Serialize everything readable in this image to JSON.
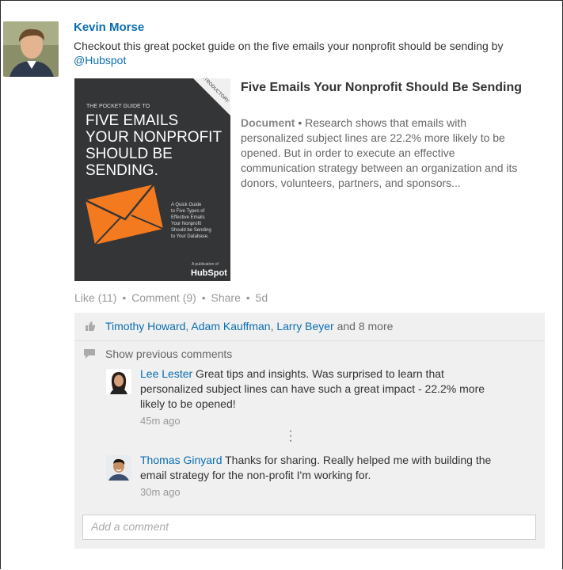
{
  "post": {
    "author": "Kevin Morse",
    "text": "Checkout this great pocket guide on the five emails your nonprofit should be sending by",
    "mention": "@Hubspot"
  },
  "document": {
    "thumbnail": {
      "banner": "INTRODUCTORY",
      "kicker": "THE POCKET GUIDE TO",
      "title_lines": [
        "FIVE EMAILS",
        "YOUR NONPROFIT",
        "SHOULD BE",
        "SENDING."
      ],
      "blurb_lines": [
        "A Quick Guide",
        "to Five Types of",
        "Effective Emails",
        "Your Nonprofit",
        "Should be Sending",
        "to Your Database."
      ],
      "publisher_label": "A publication of",
      "publisher": "HubSpot",
      "accent_color": "#f47a20"
    },
    "title": "Five Emails Your Nonprofit Should Be Sending",
    "type": "Document",
    "separator": " • ",
    "description": "Research shows that emails with personalized subject lines are 22.2% more likely to be opened. But in order to execute an effective communication strategy between an organization and its donors, volunteers, partners, and sponsors..."
  },
  "actions": {
    "like": "Like (11)",
    "comment": "Comment (9)",
    "share": "Share",
    "age": "5d",
    "dot": "•"
  },
  "likes": {
    "names": [
      "Timothy Howard",
      "Adam Kauffman",
      "Larry Beyer"
    ],
    "comma": ", ",
    "more": " and 8 more"
  },
  "comments_panel": {
    "show_previous": "Show previous comments",
    "comments": [
      {
        "name": "Lee Lester",
        "text": " Great tips and insights. Was surprised to learn that personalized subject lines can have such a great impact - 22.2% more likely to be opened!",
        "time": "45m ago"
      },
      {
        "name": "Thomas Ginyard",
        "text": " Thanks for sharing. Really helped me with building the email strategy for the non-profit I'm working for.",
        "time": "30m ago"
      }
    ],
    "add_comment_placeholder": "Add a comment"
  },
  "colors": {
    "link": "#0a6db0",
    "panel_bg": "#f0f0f0",
    "thumbnail_bg": "#333537"
  }
}
